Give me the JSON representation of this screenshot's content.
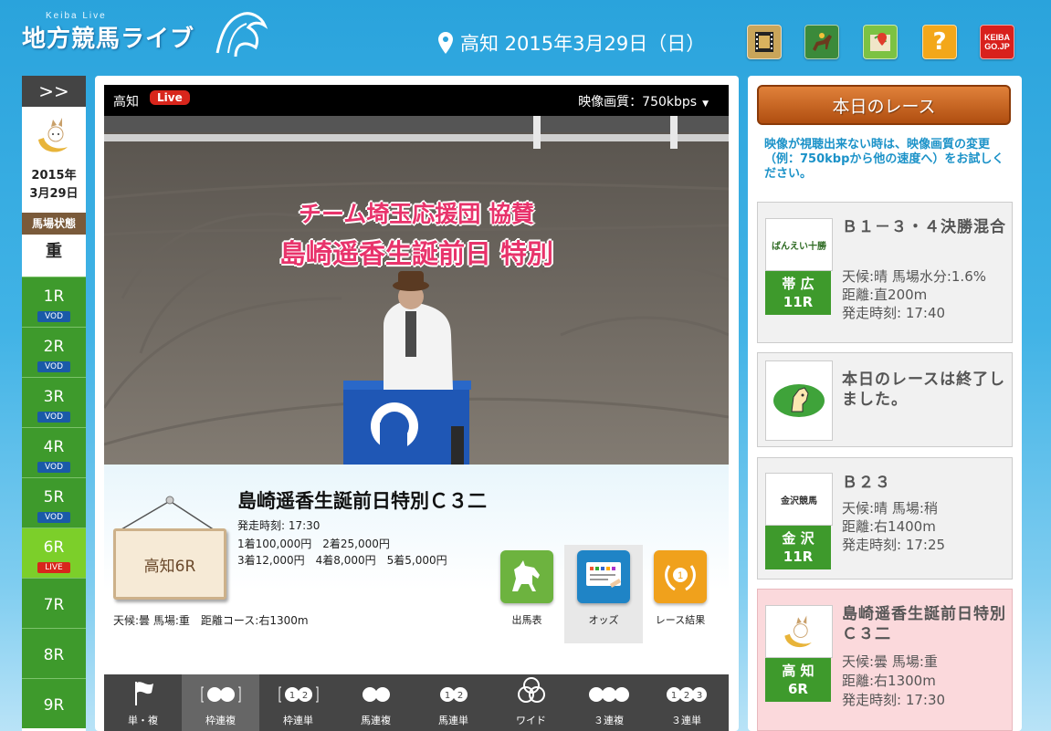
{
  "header": {
    "logo_sub": "Keiba Live",
    "logo_title": "地方競馬ライブ",
    "location_date": "高知 2015年3月29日（日）",
    "keiba_logo_text": "KEIBA GO.JP",
    "help_symbol": "?"
  },
  "sidebar": {
    "toggle": ">>",
    "date_line1": "2015年",
    "date_line2": "3月29日",
    "track_condition_label": "馬場状態",
    "track_condition": "重",
    "races": [
      {
        "label": "1R",
        "tag": "VOD"
      },
      {
        "label": "2R",
        "tag": "VOD"
      },
      {
        "label": "3R",
        "tag": "VOD"
      },
      {
        "label": "4R",
        "tag": "VOD"
      },
      {
        "label": "5R",
        "tag": "VOD"
      },
      {
        "label": "6R",
        "tag": "LIVE",
        "current": true
      },
      {
        "label": "7R",
        "tag": ""
      },
      {
        "label": "8R",
        "tag": ""
      },
      {
        "label": "9R",
        "tag": ""
      }
    ]
  },
  "video": {
    "location": "高知",
    "live_badge": "Live",
    "quality_label": "映像画質：750kbps",
    "caption_line1": "チーム埼玉応援団 協賛",
    "caption_line2": "島崎遥香生誕前日 特別"
  },
  "race_info": {
    "sign": "高知6R",
    "title": "島崎遥香生誕前日特別Ｃ３二",
    "start_time": "発走時刻: 17:30",
    "prize_line1": "1着100,000円　2着25,000円",
    "prize_line2": "3着12,000円　4着8,000円　5着5,000円",
    "conditions": "天候:曇 馬場:重　距離コース:右1300m",
    "buttons": [
      {
        "label": "出馬表",
        "color": "#6db33f"
      },
      {
        "label": "オッズ",
        "color": "#1f84c6"
      },
      {
        "label": "レース結果",
        "color": "#f0a11c"
      }
    ]
  },
  "bet_tabs": [
    {
      "label": "単・複"
    },
    {
      "label": "枠連複"
    },
    {
      "label": "枠連単"
    },
    {
      "label": "馬連複"
    },
    {
      "label": "馬連単"
    },
    {
      "label": "ワイド"
    },
    {
      "label": "３連複"
    },
    {
      "label": "３連単"
    }
  ],
  "right_panel": {
    "today_button": "本日のレース",
    "notice": "映像が視聴出来ない時は、映像画質の変更（例：750kbpから他の速度へ）をお試しください。",
    "cards": [
      {
        "venue": "帯 広",
        "race": "11R",
        "title": "Ｂ１－３・４決勝混合",
        "weather": "天候:晴 馬場水分:1.6%",
        "distance": "距離:直200m",
        "start": "発走時刻: 17:40",
        "logo_text": "ばんえい十勝"
      },
      {
        "message": "本日のレースは終了しました。"
      },
      {
        "venue": "金 沢",
        "race": "11R",
        "title": "Ｂ２３",
        "weather": "天候:晴 馬場:稍",
        "distance": "距離:右1400m",
        "start": "発走時刻: 17:25",
        "logo_text": "金沢競馬"
      },
      {
        "venue": "高 知",
        "race": "6R",
        "title": "島崎遥香生誕前日特別Ｃ３二",
        "weather": "天候:曇 馬場:重",
        "distance": "距離:右1300m",
        "start": "発走時刻: 17:30"
      }
    ]
  }
}
